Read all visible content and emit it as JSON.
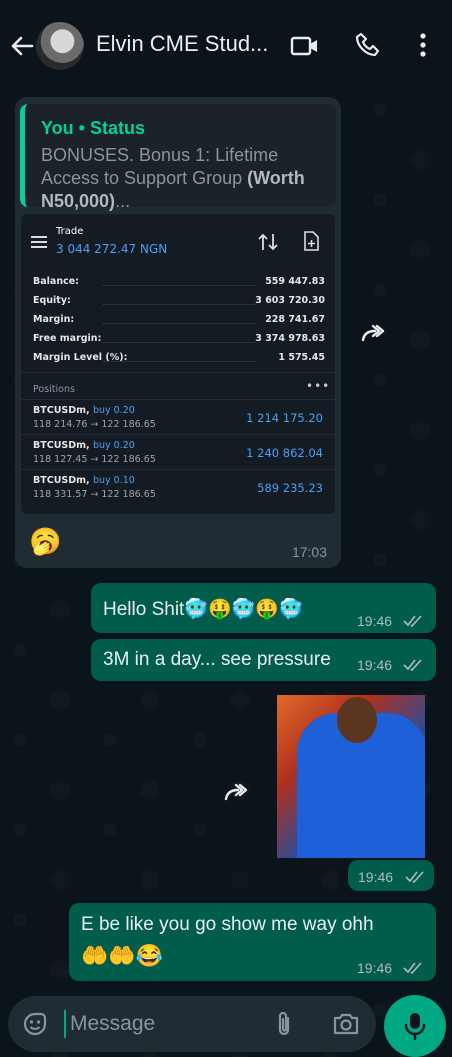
{
  "header": {
    "contact_name": "Elvin CME Stud...",
    "icons": [
      "back-arrow-icon",
      "video-call-icon",
      "phone-icon",
      "more-vert-icon"
    ]
  },
  "incoming": {
    "quote_author": "You • Status",
    "quote_text": "BONUSES. Bonus 1: Lifetime Access to Support Group ",
    "quote_bold": "(Worth N50,000)",
    "quote_tail": "...",
    "trade": {
      "title": "Trade",
      "balance_ngn": "3 044 272.47 NGN",
      "stats": [
        {
          "label": "Balance:",
          "value": "559 447.83"
        },
        {
          "label": "Equity:",
          "value": "3 603 720.30"
        },
        {
          "label": "Margin:",
          "value": "228 741.67"
        },
        {
          "label": "Free margin:",
          "value": "3 374 978.63"
        },
        {
          "label": "Margin Level (%):",
          "value": "1 575.45"
        }
      ],
      "positions_title": "Positions",
      "positions_more": "•••",
      "positions": [
        {
          "symbol": "BTCUSDm,",
          "side": "buy 0.20",
          "prices": "118 214.76 → 122 186.65",
          "profit": "1 214 175.20"
        },
        {
          "symbol": "BTCUSDm,",
          "side": "buy 0.20",
          "prices": "118 127.45 → 122 186.65",
          "profit": "1 240 862.04"
        },
        {
          "symbol": "BTCUSDm,",
          "side": "buy 0.10",
          "prices": "118 331.57 → 122 186.65",
          "profit": "589 235.23"
        }
      ]
    },
    "reaction_emoji": "🥱",
    "time": "17:03"
  },
  "outgoing": [
    {
      "text": "Hello Shit🥶🤑🥶🤑🥶",
      "time": "19:46"
    },
    {
      "text": "3M in a day... see pressure",
      "time": "19:46"
    },
    {
      "text": "",
      "time": "19:46"
    },
    {
      "text": "E be like you go show me way ohh",
      "text2": "🤲🤲😂",
      "time": "19:46"
    }
  ],
  "composer": {
    "placeholder": "Message"
  },
  "colors": {
    "background": "#0b141a",
    "incoming_bubble": "#202c33",
    "outgoing_bubble": "#005c4b",
    "accent": "#00a884",
    "tick": "#8696a0"
  }
}
